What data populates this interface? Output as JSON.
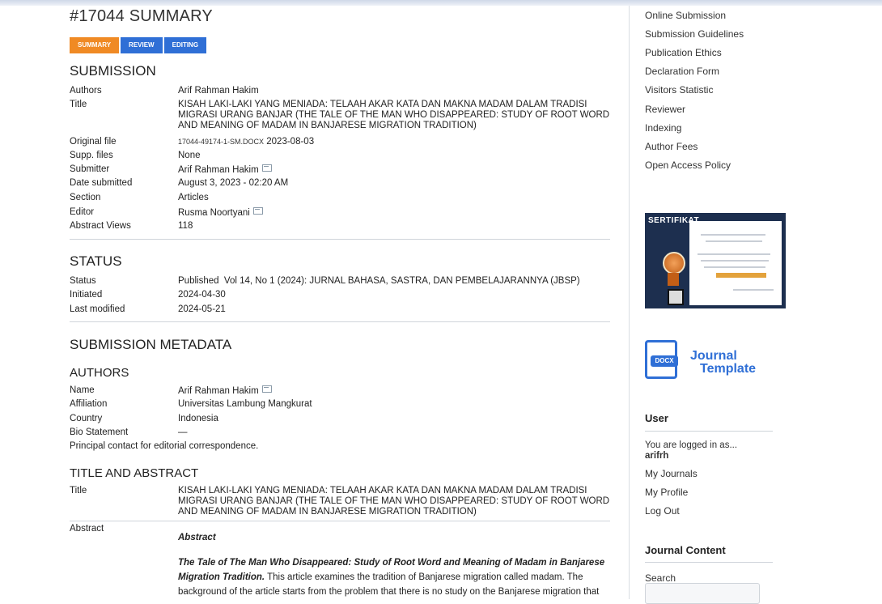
{
  "page": {
    "title": "#17044 SUMMARY"
  },
  "tabs": [
    {
      "label": "SUMMARY",
      "active": true
    },
    {
      "label": "REVIEW",
      "active": false
    },
    {
      "label": "EDITING",
      "active": false
    }
  ],
  "submission": {
    "heading": "SUBMISSION",
    "authors_label": "Authors",
    "authors": "Arif Rahman Hakim",
    "title_label": "Title",
    "title": "KISAH LAKI-LAKI YANG MENIADA: TELAAH AKAR KATA DAN MAKNA MADAM DALAM TRADISI MIGRASI URANG BANJAR (THE TALE OF THE MAN WHO DISAPPEARED: STUDY OF ROOT WORD AND MEANING OF MADAM IN BANJARESE MIGRATION TRADITION)",
    "original_file_label": "Original file",
    "original_file_name": "17044-49174-1-SM.DOCX",
    "original_file_date": "2023-08-03",
    "supp_label": "Supp. files",
    "supp": "None",
    "submitter_label": "Submitter",
    "submitter": "Arif Rahman Hakim",
    "date_label": "Date submitted",
    "date": "August 3, 2023 - 02:20 AM",
    "section_label": "Section",
    "section": "Articles",
    "editor_label": "Editor",
    "editor": "Rusma Noortyani",
    "views_label": "Abstract Views",
    "views": "118"
  },
  "status": {
    "heading": "STATUS",
    "status_label": "Status",
    "status": "Published",
    "issue": "Vol 14, No 1 (2024): JURNAL BAHASA, SASTRA, DAN PEMBELAJARANNYA (JBSP)",
    "initiated_label": "Initiated",
    "initiated": "2024-04-30",
    "modified_label": "Last modified",
    "modified": "2024-05-21"
  },
  "metadata": {
    "heading": "SUBMISSION METADATA",
    "authors_heading": "AUTHORS",
    "name_label": "Name",
    "name": "Arif Rahman Hakim",
    "affiliation_label": "Affiliation",
    "affiliation": "Universitas Lambung Mangkurat",
    "country_label": "Country",
    "country": "Indonesia",
    "bio_label": "Bio Statement",
    "bio": "—",
    "principal": "Principal contact for editorial correspondence.",
    "ta_heading": "TITLE AND ABSTRACT",
    "ta_title_label": "Title",
    "ta_title": "KISAH LAKI-LAKI YANG MENIADA: TELAAH AKAR KATA DAN MAKNA MADAM DALAM TRADISI MIGRASI URANG BANJAR (THE TALE OF THE MAN WHO DISAPPEARED: STUDY OF ROOT WORD AND MEANING OF MADAM IN BANJARESE MIGRATION TRADITION)",
    "abstract_label": "Abstract",
    "abstract_heading": "Abstract",
    "abstract_lead": "The Tale of The Man Who Disappeared: Study of Root Word and Meaning of Madam in Banjarese Migration Tradition.",
    "abstract_text": "This article examines the tradition of Banjarese migration called madam. The background of the article starts from the problem that there is no study on the Banjarese migration that"
  },
  "sidebar": {
    "links": [
      "Online Submission",
      "Submission Guidelines",
      "Publication Ethics",
      "Declaration Form",
      "Visitors Statistic",
      "Reviewer",
      "Indexing",
      "Author Fees",
      "Open Access Policy"
    ],
    "cert_title": "SERTIFIKAT",
    "template_icon_label": "DOCX",
    "template_line1": "Journal",
    "template_line2": "Template",
    "user_heading": "User",
    "logged_in": "You are logged in as...",
    "username": "arifrh",
    "user_links": [
      "My Journals",
      "My Profile",
      "Log Out"
    ],
    "content_heading": "Journal Content",
    "search_label": "Search"
  }
}
